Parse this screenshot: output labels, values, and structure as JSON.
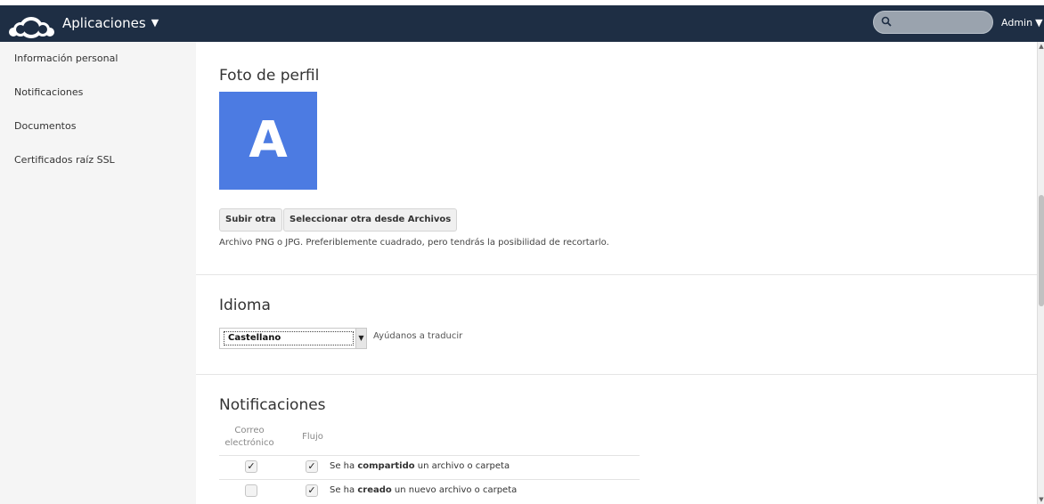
{
  "header": {
    "app_menu_label": "Aplicaciones",
    "app_menu_caret": "▼",
    "search_placeholder": "",
    "user_label": "Admin",
    "user_caret": "▼"
  },
  "sidebar": {
    "items": [
      {
        "label": "Información personal"
      },
      {
        "label": "Notificaciones"
      },
      {
        "label": "Documentos"
      },
      {
        "label": "Certificados raíz SSL"
      }
    ]
  },
  "profile": {
    "title": "Foto de perfil",
    "avatar_letter": "A",
    "avatar_color": "#4c7be2",
    "upload_button": "Subir otra",
    "select_button": "Seleccionar otra desde Archivos",
    "hint": "Archivo PNG o JPG. Preferiblemente cuadrado, pero tendrás la posibilidad de recortarlo."
  },
  "language": {
    "title": "Idioma",
    "selected": "Castellano",
    "help_link": "Ayúdanos a traducir"
  },
  "notifications": {
    "title": "Notificaciones",
    "col_email": "Correo electrónico",
    "col_stream": "Flujo",
    "rows": [
      {
        "email_checked": true,
        "stream_checked": true,
        "text_pre": "Se ha ",
        "text_bold": "compartido",
        "text_post": " un archivo o carpeta"
      },
      {
        "email_checked": false,
        "stream_checked": true,
        "text_pre": "Se ha ",
        "text_bold": "creado",
        "text_post": " un nuevo archivo o carpeta"
      }
    ]
  },
  "colors": {
    "header_bg": "#1e2e44",
    "sidebar_bg": "#f5f5f5"
  }
}
